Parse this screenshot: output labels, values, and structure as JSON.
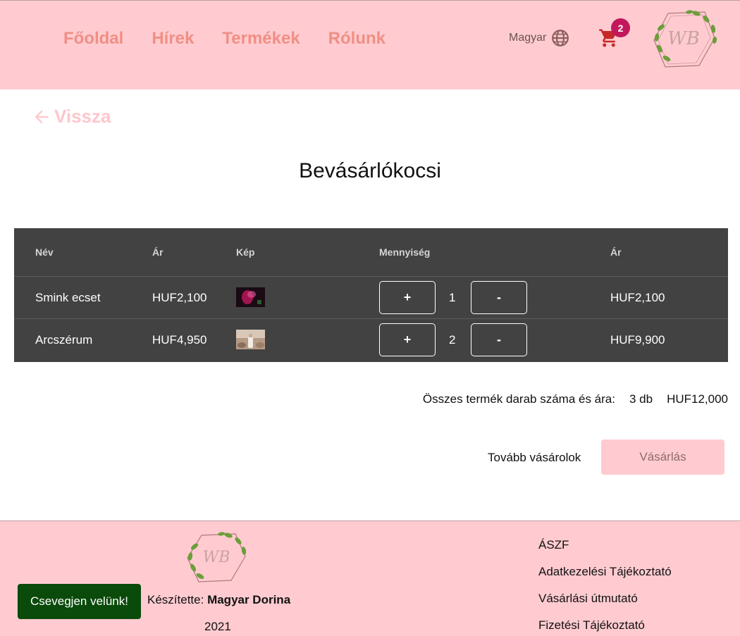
{
  "header": {
    "nav": [
      "Főoldal",
      "Hírek",
      "Termékek",
      "Rólunk"
    ],
    "language": "Magyar",
    "cart_count": "2",
    "logo_text": "WB"
  },
  "back_label": "Vissza",
  "page_title": "Bevásárlókocsi",
  "table": {
    "headers": [
      "Név",
      "Ár",
      "Kép",
      "Mennyiség",
      "Ár"
    ],
    "rows": [
      {
        "name": "Smink ecset",
        "price": "HUF2,100",
        "qty": "1",
        "total": "HUF2,100",
        "plus": "+",
        "minus": "-"
      },
      {
        "name": "Arcszérum",
        "price": "HUF4,950",
        "qty": "2",
        "total": "HUF9,900",
        "plus": "+",
        "minus": "-"
      }
    ]
  },
  "summary": {
    "label": "Összes termék darab száma és ára:",
    "count": "3 db",
    "total": "HUF12,000"
  },
  "continue_label": "Tovább vásárolok",
  "buy_label": "Vásárlás",
  "footer": {
    "credit_prefix": "Készítette:",
    "credit_name": "Magyar Dorina",
    "year": "2021",
    "links": [
      "ÁSZF",
      "Adatkezelési Tájékoztató",
      "Vásárlási útmutató",
      "Fizetési Tájékoztató"
    ]
  },
  "chat_label": "Csevegjen velünk!",
  "colors": {
    "header_bg": "#ffcbd0",
    "nav_text": "#f08f84",
    "table_bg": "#424242",
    "badge": "#c2185b",
    "chat_bg": "#0a4a0a"
  }
}
